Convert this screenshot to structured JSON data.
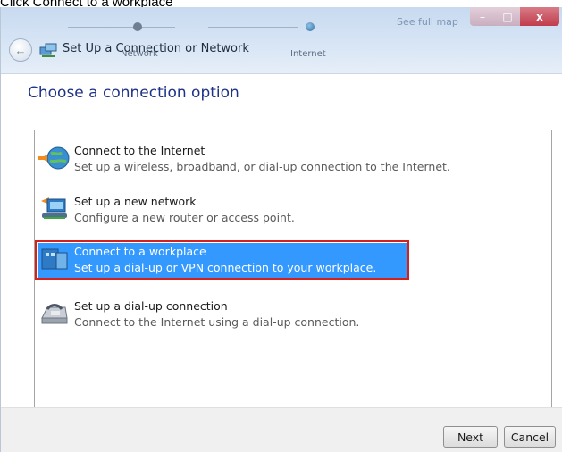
{
  "caption": "Click Connect to a workplace",
  "window": {
    "title": "Set Up a Connection or Network",
    "see_full_map": "See full map",
    "map_labels": [
      "Network",
      "Internet"
    ],
    "controls": {
      "minimize": "–",
      "maximize": "□",
      "close": "x"
    }
  },
  "heading": "Choose a connection option",
  "options": [
    {
      "title": "Connect to the Internet",
      "description": "Set up a wireless, broadband, or dial-up connection to the Internet.",
      "icon": "globe-connect-icon",
      "selected": false
    },
    {
      "title": "Set up a new network",
      "description": "Configure a new router or access point.",
      "icon": "router-icon",
      "selected": false
    },
    {
      "title": "Connect to a workplace",
      "description": "Set up a dial-up or VPN connection to your workplace.",
      "icon": "workplace-icon",
      "selected": true
    },
    {
      "title": "Set up a dial-up connection",
      "description": "Connect to the Internet using a dial-up connection.",
      "icon": "fax-modem-icon",
      "selected": false
    }
  ],
  "buttons": {
    "next": "Next",
    "cancel": "Cancel"
  },
  "colors": {
    "selection": "#3399ff",
    "highlight_frame": "#d7201a",
    "heading": "#1e3287"
  }
}
